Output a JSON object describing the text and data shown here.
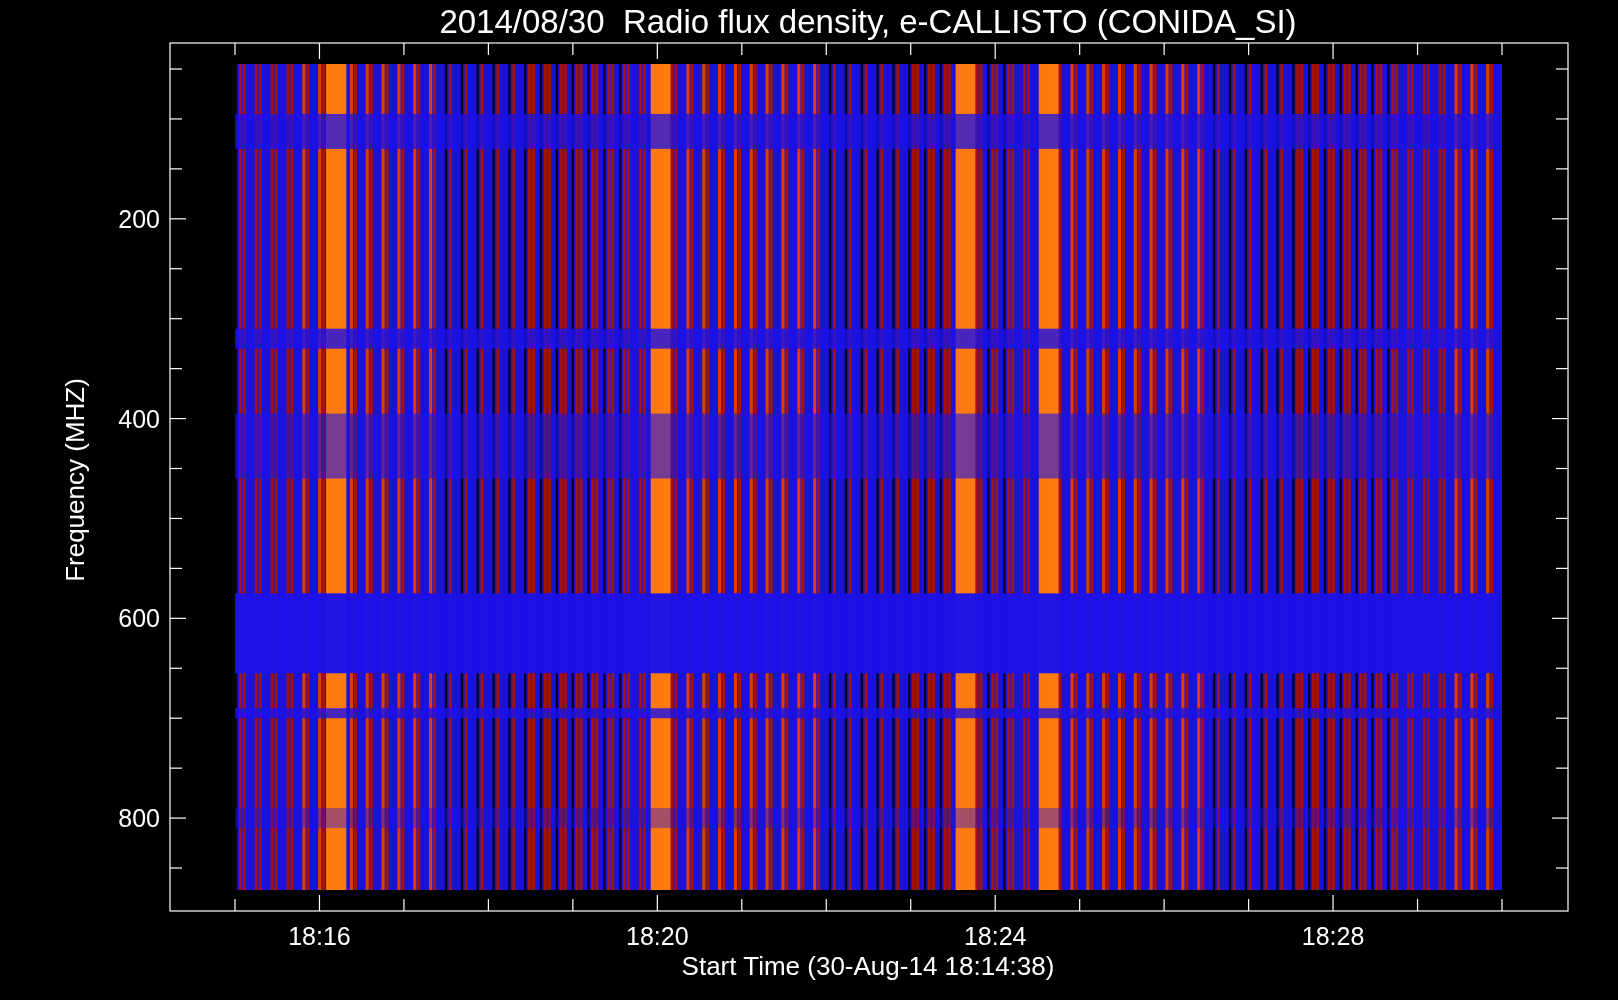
{
  "title": "2014/08/30  Radio flux density, e-CALLISTO (CONIDA_SI)",
  "y_axis": {
    "label": "Frequency (MHZ)",
    "ticks": [
      "200",
      "400",
      "600",
      "800"
    ]
  },
  "x_axis": {
    "label": "Start Time (30-Aug-14 18:14:38)",
    "ticks": [
      "18:16",
      "18:20",
      "18:24",
      "18:28"
    ]
  }
}
